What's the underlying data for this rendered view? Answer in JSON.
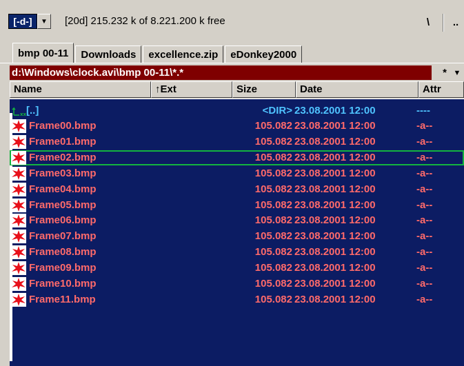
{
  "drivebar": {
    "drive_label": "[-d-]",
    "drive_arrow": "▼",
    "free_text": "[20d]  215.232 k of 8.221.200 k free",
    "root_btn": "\\",
    "up_btn": ".."
  },
  "tabs": [
    {
      "label": "bmp 00-11",
      "active": true
    },
    {
      "label": "Downloads",
      "active": false
    },
    {
      "label": "excellence.zip",
      "active": false
    },
    {
      "label": "eDonkey2000",
      "active": false
    }
  ],
  "path": {
    "text": "d:\\Windows\\clock.avi\\bmp 00-11\\*.*",
    "filter_btn": "*",
    "history_btn": "▼"
  },
  "columns": {
    "name": "Name",
    "ext": "↑Ext",
    "size": "Size",
    "date": "Date",
    "attr": "Attr"
  },
  "parent_row": {
    "name": "[..]",
    "size": "<DIR>",
    "date": "23.08.2001 12:00",
    "attr": "----"
  },
  "files": [
    {
      "name": "Frame00.bmp",
      "size": "105.082",
      "date": "23.08.2001 12:00",
      "attr": "-a--"
    },
    {
      "name": "Frame01.bmp",
      "size": "105.082",
      "date": "23.08.2001 12:00",
      "attr": "-a--"
    },
    {
      "name": "Frame02.bmp",
      "size": "105.082",
      "date": "23.08.2001 12:00",
      "attr": "-a--",
      "selected": true
    },
    {
      "name": "Frame03.bmp",
      "size": "105.082",
      "date": "23.08.2001 12:00",
      "attr": "-a--"
    },
    {
      "name": "Frame04.bmp",
      "size": "105.082",
      "date": "23.08.2001 12:00",
      "attr": "-a--"
    },
    {
      "name": "Frame05.bmp",
      "size": "105.082",
      "date": "23.08.2001 12:00",
      "attr": "-a--"
    },
    {
      "name": "Frame06.bmp",
      "size": "105.082",
      "date": "23.08.2001 12:00",
      "attr": "-a--"
    },
    {
      "name": "Frame07.bmp",
      "size": "105.082",
      "date": "23.08.2001 12:00",
      "attr": "-a--"
    },
    {
      "name": "Frame08.bmp",
      "size": "105.082",
      "date": "23.08.2001 12:00",
      "attr": "-a--"
    },
    {
      "name": "Frame09.bmp",
      "size": "105.082",
      "date": "23.08.2001 12:00",
      "attr": "-a--"
    },
    {
      "name": "Frame10.bmp",
      "size": "105.082",
      "date": "23.08.2001 12:00",
      "attr": "-a--"
    },
    {
      "name": "Frame11.bmp",
      "size": "105.082",
      "date": "23.08.2001 12:00",
      "attr": "-a--"
    }
  ],
  "colors": {
    "list_bg": "#0c1c63",
    "file_text": "#ff6a6a",
    "parent_text": "#4fc3ff",
    "path_bg": "#7f0000",
    "selection": "#13b43f"
  },
  "icons": {
    "file": "bitmap-file-icon",
    "parent": "up-folder-icon"
  }
}
